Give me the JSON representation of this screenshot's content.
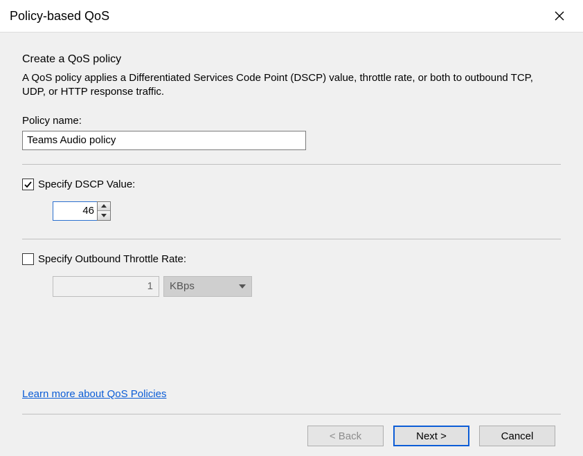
{
  "window": {
    "title": "Policy-based QoS"
  },
  "page": {
    "heading": "Create a QoS policy",
    "description": "A QoS policy applies a Differentiated Services Code Point (DSCP) value, throttle rate, or both to outbound TCP, UDP, or HTTP response traffic.",
    "policy_name_label": "Policy name:",
    "policy_name_value": "Teams Audio policy"
  },
  "dscp": {
    "checkbox_label": "Specify DSCP Value:",
    "checked": true,
    "value": "46"
  },
  "throttle": {
    "checkbox_label": "Specify Outbound Throttle Rate:",
    "checked": false,
    "value": "1",
    "unit": "KBps"
  },
  "link": {
    "label": "Learn more about QoS Policies"
  },
  "buttons": {
    "back": "< Back",
    "next": "Next >",
    "cancel": "Cancel"
  }
}
